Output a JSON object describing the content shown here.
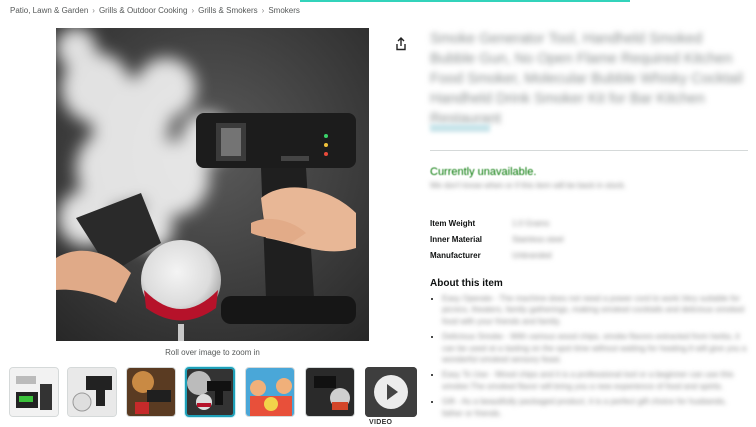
{
  "colors": {
    "accent": "#33d3bb",
    "selected_border": "#1fa0b8",
    "available_green": "#007600",
    "link_blue": "#007185"
  },
  "breadcrumb": [
    {
      "label": "Patio, Lawn & Garden"
    },
    {
      "label": "Grills & Outdoor Cooking"
    },
    {
      "label": "Grills & Smokers"
    },
    {
      "label": "Smokers"
    }
  ],
  "breadcrumb_separator": "›",
  "share_icon": "share-icon",
  "gallery": {
    "zoom_hint": "Roll over image to zoom in",
    "video_label": "VIDEO",
    "selected_index": 3,
    "thumb_count": 6
  },
  "product": {
    "title": "Smoke Generator Tool, Handheld Smoked Bubble Gun, No Open Flame Required Kitchen Food Smoker, Molecular Bubble Whisky Cocktail Handheld Drink Smoker Kit for Bar Kitchen Restaurant",
    "availability": "Currently unavailable.",
    "availability_note": "We don't know when or if this item will be back in stock.",
    "specs": [
      {
        "key": "Item Weight",
        "value": "1.0 Grams"
      },
      {
        "key": "Inner Material",
        "value": "Stainless steel"
      },
      {
        "key": "Manufacturer",
        "value": "Unbranded"
      }
    ]
  },
  "about": {
    "heading": "About this item",
    "bullets": [
      "Easy Operate - The machine does not need a power cord to work.Very suitable for picnics, theaters, family gatherings, making smoked cocktails and delicious smoked food with your friends and family.",
      "Delicious Smoke - With various wood chips, smoke flavors extracted from herbs, it can be used at a tasting on the spot time without waiting for heating.It will give you a wonderful smoked sensory feast.",
      "Easy To Use - Wood chips and it is a professional tool or a beginner can use this smoker.The smoked flavor will bring you a new experience of food and spirits.",
      "Gift - As a beautifully packaged product, it is a perfect gift choice for husbands, father or friends."
    ]
  }
}
